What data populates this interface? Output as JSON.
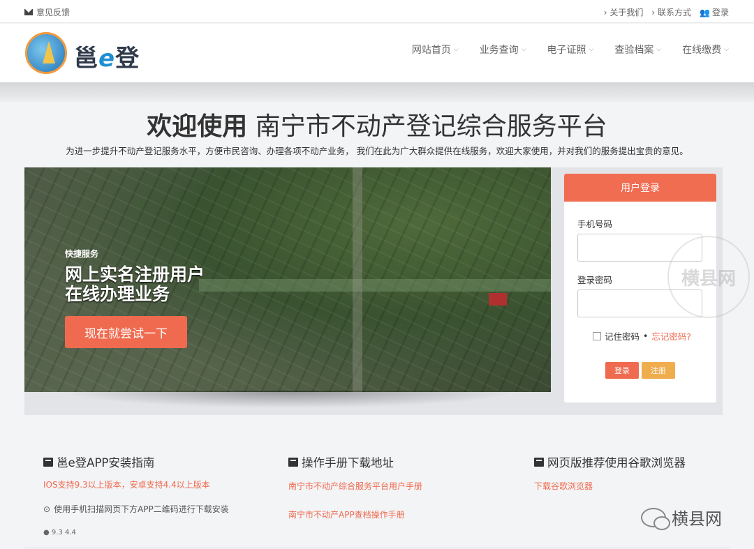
{
  "topbar": {
    "feedback": "意见反馈",
    "about": "› 关于我们",
    "contact": "› 联系方式",
    "login": "登录"
  },
  "header": {
    "logo_text_1": "邕",
    "logo_text_e": "e",
    "logo_text_2": "登",
    "nav": [
      {
        "label": "网站首页"
      },
      {
        "label": "业务查询"
      },
      {
        "label": "电子证照"
      },
      {
        "label": "查验档案"
      },
      {
        "label": "在线缴费"
      }
    ]
  },
  "hero": {
    "title_bold": "欢迎使用",
    "title_rest": " 南宁市不动产登记综合服务平台",
    "subtitle": "为进一步提升不动产登记服务水平，方便市民咨询、办理各项不动产业务， 我们在此为广大群众提供在线服务，欢迎大家使用，并对我们的服务提出宝贵的意见。"
  },
  "banner": {
    "quick": "快捷服务",
    "line1": "网上实名注册用户",
    "line2": "在线办理业务",
    "try_button": "现在就尝试一下"
  },
  "login": {
    "header": "用户登录",
    "phone_label": "手机号码",
    "password_label": "登录密码",
    "remember": "记住密码",
    "separator": "•",
    "forgot": "忘记密码?",
    "login_button": "登录",
    "register_button": "注册"
  },
  "columns": {
    "app": {
      "title": "邕e登APP安装指南",
      "note": "IOS支持9.3以上版本，安卓支持4.4以上版本",
      "scan": "使用手机扫描网页下方APP二维码进行下载安装",
      "versions": "9.3  4.4"
    },
    "manual": {
      "title": "操作手册下载地址",
      "link1": "南宁市不动产综合服务平台用户手册",
      "link2": "南宁市不动产APP查档操作手册"
    },
    "browser": {
      "title": "网页版推荐使用谷歌浏览器",
      "link": "下载谷歌浏览器"
    }
  },
  "watermark": {
    "stamp": "横县网",
    "wechat": "横县网"
  }
}
